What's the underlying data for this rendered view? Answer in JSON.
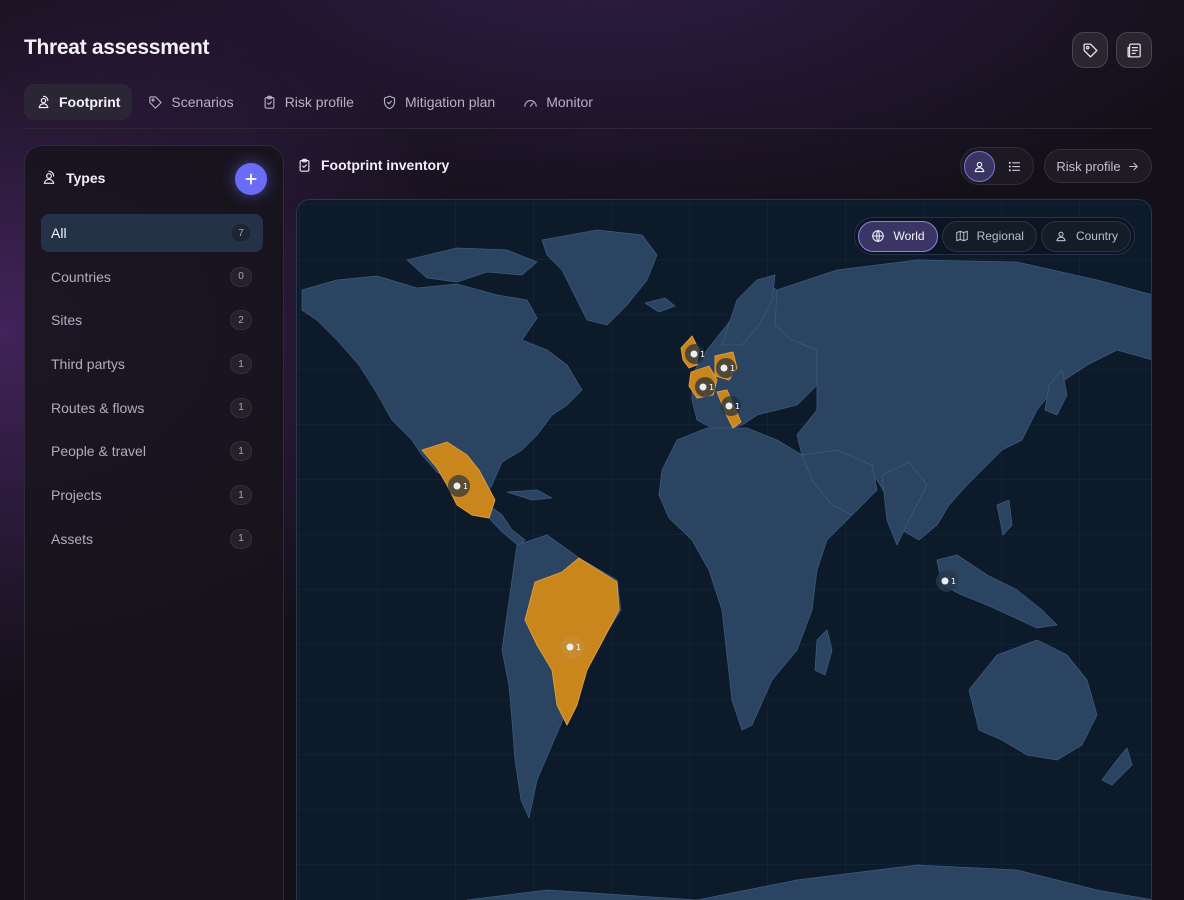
{
  "page": {
    "title": "Threat assessment",
    "header_buttons": [
      {
        "icon": "tag-icon"
      },
      {
        "icon": "newspaper-icon"
      }
    ]
  },
  "tabs": [
    {
      "label": "Footprint",
      "icon": "user-pin-icon",
      "active": true
    },
    {
      "label": "Scenarios",
      "icon": "tag-icon",
      "active": false
    },
    {
      "label": "Risk profile",
      "icon": "clipboard-icon",
      "active": false
    },
    {
      "label": "Mitigation plan",
      "icon": "shield-icon",
      "active": false
    },
    {
      "label": "Monitor",
      "icon": "gauge-icon",
      "active": false
    }
  ],
  "sidebar": {
    "title": "Types",
    "add_icon": "plus-icon",
    "items": [
      {
        "label": "All",
        "count": "7",
        "active": true
      },
      {
        "label": "Countries",
        "count": "0",
        "active": false
      },
      {
        "label": "Sites",
        "count": "2",
        "active": false
      },
      {
        "label": "Third partys",
        "count": "1",
        "active": false
      },
      {
        "label": "Routes & flows",
        "count": "1",
        "active": false
      },
      {
        "label": "People & travel",
        "count": "1",
        "active": false
      },
      {
        "label": "Projects",
        "count": "1",
        "active": false
      },
      {
        "label": "Assets",
        "count": "1",
        "active": false
      }
    ]
  },
  "main": {
    "title": "Footprint inventory",
    "view_toggle": [
      {
        "icon": "map-pin-person-icon",
        "active": true
      },
      {
        "icon": "list-icon",
        "active": false
      }
    ],
    "risk_button": "Risk profile"
  },
  "map": {
    "scale_options": [
      {
        "label": "World",
        "icon": "globe-icon",
        "active": true
      },
      {
        "label": "Regional",
        "icon": "map-icon",
        "active": false
      },
      {
        "label": "Country",
        "icon": "user-pin-icon",
        "active": false
      }
    ],
    "highlighted_regions": [
      "Mexico",
      "Brazil",
      "United Kingdom",
      "Germany",
      "France",
      "Italy"
    ],
    "markers": [
      {
        "place": "United Kingdom",
        "count": "1"
      },
      {
        "place": "Germany",
        "count": "1"
      },
      {
        "place": "France",
        "count": "1"
      },
      {
        "place": "Italy",
        "count": "1"
      },
      {
        "place": "Mexico",
        "count": "1"
      },
      {
        "place": "Brazil",
        "count": "1"
      },
      {
        "place": "Malaysia",
        "count": "1"
      }
    ],
    "colors": {
      "ocean": "#0c1a2a",
      "land": "#2a4462",
      "highlight": "#c8861c",
      "accent": "#6b6cf6"
    }
  }
}
